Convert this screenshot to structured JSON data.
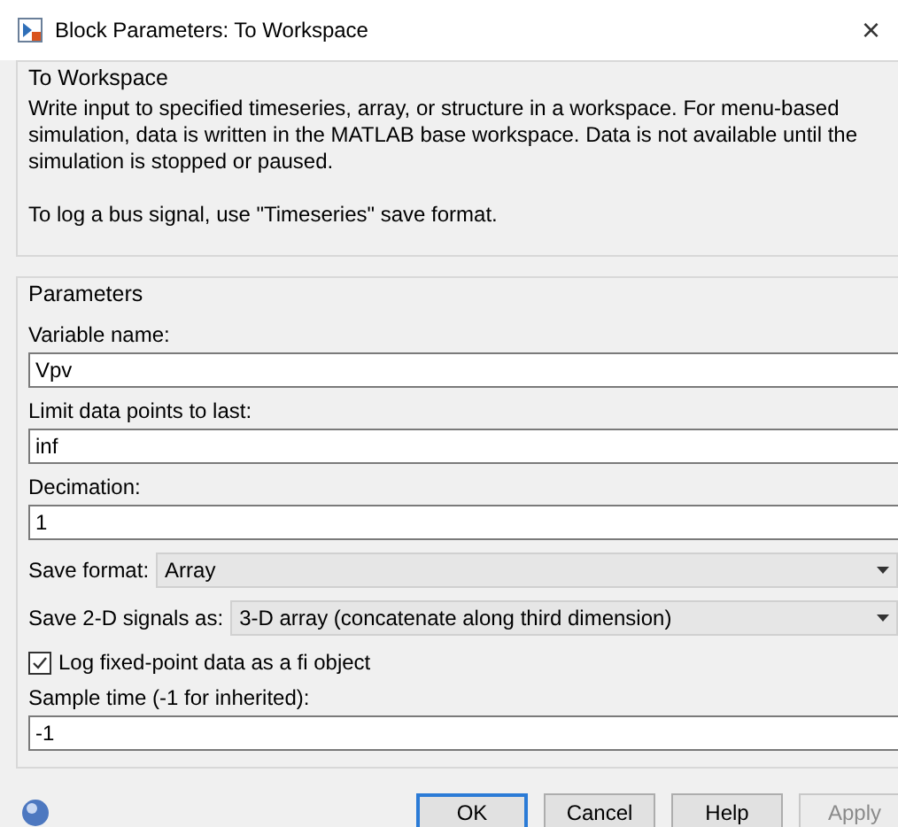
{
  "window": {
    "title": "Block Parameters: To Workspace",
    "close": "×"
  },
  "description_group": {
    "title": "To Workspace",
    "paragraphs": [
      "Write input to specified timeseries, array, or structure in a workspace. For menu-based simulation, data is written in the MATLAB base workspace. Data is not available until the simulation is stopped or paused.",
      "To log a bus signal, use \"Timeseries\" save format."
    ]
  },
  "parameters_group": {
    "title": "Parameters",
    "items": [
      {
        "kind": "field",
        "label": "Variable name:",
        "value": "Vpv"
      },
      {
        "kind": "field",
        "label": "Limit data points to last:",
        "value": "inf"
      },
      {
        "kind": "field",
        "label": "Decimation:",
        "value": "1"
      },
      {
        "kind": "dropdown",
        "label": "Save format:",
        "value": "Array"
      },
      {
        "kind": "dropdown",
        "label": "Save 2-D signals as:",
        "value": "3-D array (concatenate along third dimension)"
      },
      {
        "kind": "checkbox",
        "label": "Log fixed-point data as a fi object",
        "checked": true
      },
      {
        "kind": "field",
        "label": "Sample time (-1 for inherited):",
        "value": "-1"
      }
    ]
  },
  "buttons": [
    {
      "label": "OK",
      "default": true,
      "disabled": false
    },
    {
      "label": "Cancel",
      "default": false,
      "disabled": false
    },
    {
      "label": "Help",
      "default": false,
      "disabled": false
    },
    {
      "label": "Apply",
      "default": false,
      "disabled": true
    }
  ]
}
